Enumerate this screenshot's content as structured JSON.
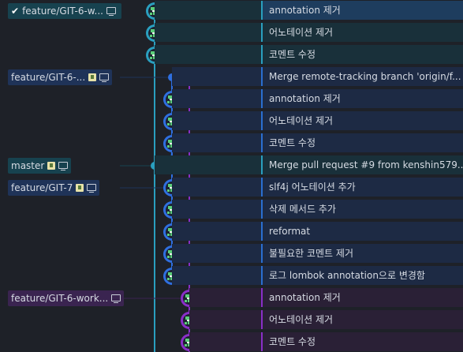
{
  "colors": {
    "cyan": "#2a9fbf",
    "blue": "#2f6fe0",
    "purple": "#8a2fc8",
    "avatar_green": "#5ccf7a"
  },
  "branch_labels": [
    {
      "text": "feature/GIT-6-w...",
      "current": true,
      "checkmark": "✔",
      "icons": [
        "monitor-icon"
      ],
      "color": "cyan"
    },
    {
      "text": "feature/GIT-6-...",
      "icons": [
        "remote-icon",
        "monitor-icon"
      ],
      "color": "blue"
    },
    {
      "text": "master",
      "icons": [
        "remote-icon",
        "monitor-icon"
      ],
      "color": "cyan"
    },
    {
      "text": "feature/GIT-7",
      "icons": [
        "remote-icon",
        "monitor-icon"
      ],
      "color": "blue"
    },
    {
      "text": "feature/GIT-6-work...",
      "icons": [
        "monitor-icon"
      ],
      "color": "purple"
    }
  ],
  "commits": [
    {
      "message": "annotation 제거",
      "lane": "cyan",
      "label_index": 0,
      "selected": true
    },
    {
      "message": "어노테이션 제거",
      "lane": "cyan"
    },
    {
      "message": "코멘트 수정",
      "lane": "cyan"
    },
    {
      "message": "Merge remote-tracking branch 'origin/f...",
      "lane": "blue",
      "label_index": 1,
      "merge": true
    },
    {
      "message": "annotation 제거",
      "lane": "blue"
    },
    {
      "message": "어노테이션 제거",
      "lane": "blue"
    },
    {
      "message": "코멘트 수정",
      "lane": "blue"
    },
    {
      "message": "Merge pull request #9 from kenshin579...",
      "lane": "cyan",
      "label_index": 2,
      "merge": true
    },
    {
      "message": "slf4j 어노테이션 추가",
      "lane": "blue",
      "label_index": 3
    },
    {
      "message": "삭제 메서드 추가",
      "lane": "blue"
    },
    {
      "message": "reformat",
      "lane": "blue"
    },
    {
      "message": "불필요한 코멘트 제거",
      "lane": "blue"
    },
    {
      "message": "로그 lombok annotation으로 변경함",
      "lane": "blue"
    },
    {
      "message": "annotation 제거",
      "lane": "purple",
      "label_index": 4
    },
    {
      "message": "어노테이션 제거",
      "lane": "purple"
    },
    {
      "message": "코멘트 수정",
      "lane": "purple"
    }
  ]
}
